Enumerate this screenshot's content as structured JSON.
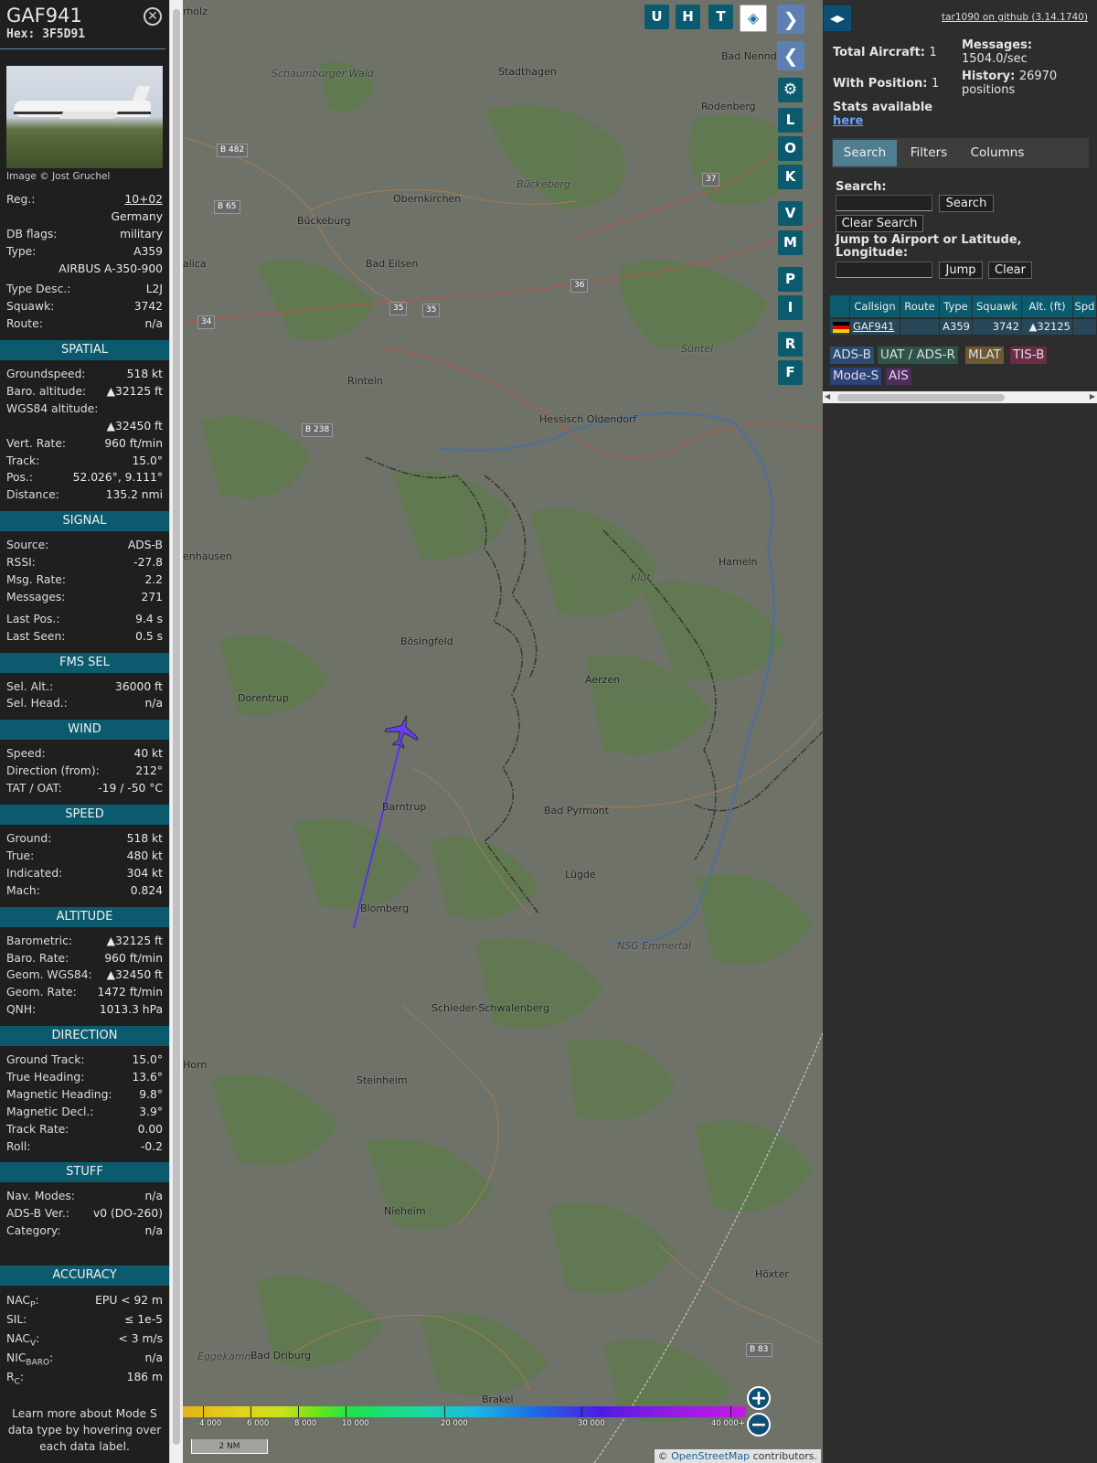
{
  "aircraft": {
    "callsign": "GAF941",
    "hex_label": "Hex:",
    "hex": "3F5D91",
    "photo_credit": "Image © Jost Gruchel"
  },
  "identity": [
    {
      "label": "Reg.:",
      "value": "10+02"
    },
    {
      "label": "",
      "value": "Germany"
    },
    {
      "label": "DB flags:",
      "value": "military"
    },
    {
      "label": "Type:",
      "value": "A359"
    },
    {
      "label": "",
      "value": "AIRBUS A-350-900"
    },
    {
      "label": "Type Desc.:",
      "value": "L2J"
    },
    {
      "label": "Squawk:",
      "value": "3742"
    },
    {
      "label": "Route:",
      "value": "n/a"
    }
  ],
  "sections": [
    {
      "title": "SPATIAL",
      "rows": [
        {
          "label": "Groundspeed:",
          "value": "518 kt"
        },
        {
          "label": "Baro. altitude:",
          "value": "▲32125 ft"
        },
        {
          "label": "WGS84 altitude:",
          "value": ""
        },
        {
          "label": "",
          "value": "▲32450 ft"
        },
        {
          "label": "Vert. Rate:",
          "value": "960 ft/min"
        },
        {
          "label": "Track:",
          "value": "15.0°"
        },
        {
          "label": "Pos.:",
          "value": "52.026°, 9.111°"
        },
        {
          "label": "Distance:",
          "value": "135.2 nmi"
        }
      ]
    },
    {
      "title": "SIGNAL",
      "rows": [
        {
          "label": "Source:",
          "value": "ADS-B"
        },
        {
          "label": "RSSI:",
          "value": "-27.8"
        },
        {
          "label": "Msg. Rate:",
          "value": "2.2"
        },
        {
          "label": "Messages:",
          "value": "271"
        },
        {
          "label": "Last Pos.:",
          "value": "9.4 s"
        },
        {
          "label": "Last Seen:",
          "value": "0.5 s"
        }
      ]
    },
    {
      "title": "FMS SEL",
      "rows": [
        {
          "label": "Sel. Alt.:",
          "value": "36000 ft"
        },
        {
          "label": "Sel. Head.:",
          "value": "n/a"
        }
      ]
    },
    {
      "title": "WIND",
      "rows": [
        {
          "label": "Speed:",
          "value": "40 kt"
        },
        {
          "label": "Direction (from):",
          "value": "212°"
        },
        {
          "label": "TAT / OAT:",
          "value": "-19 / -50 °C"
        }
      ]
    },
    {
      "title": "SPEED",
      "rows": [
        {
          "label": "Ground:",
          "value": "518 kt"
        },
        {
          "label": "True:",
          "value": "480 kt"
        },
        {
          "label": "Indicated:",
          "value": "304 kt"
        },
        {
          "label": "Mach:",
          "value": "0.824"
        }
      ]
    },
    {
      "title": "ALTITUDE",
      "rows": [
        {
          "label": "Barometric:",
          "value": "▲32125 ft"
        },
        {
          "label": "Baro. Rate:",
          "value": "960 ft/min"
        },
        {
          "label": "Geom. WGS84:",
          "value": "▲32450 ft"
        },
        {
          "label": "Geom. Rate:",
          "value": "1472 ft/min"
        },
        {
          "label": "QNH:",
          "value": "1013.3 hPa"
        }
      ]
    },
    {
      "title": "DIRECTION",
      "rows": [
        {
          "label": "Ground Track:",
          "value": "15.0°"
        },
        {
          "label": "True Heading:",
          "value": "13.6°"
        },
        {
          "label": "Magnetic Heading:",
          "value": "9.8°"
        },
        {
          "label": "Magnetic Decl.:",
          "value": "3.9°"
        },
        {
          "label": "Track Rate:",
          "value": "0.00"
        },
        {
          "label": "Roll:",
          "value": "-0.2"
        }
      ]
    },
    {
      "title": "STUFF",
      "rows": [
        {
          "label": "Nav. Modes:",
          "value": "n/a"
        },
        {
          "label": "ADS-B Ver.:",
          "value": "v0 (DO-260)"
        },
        {
          "label": "Category:",
          "value": "n/a"
        }
      ]
    }
  ],
  "accuracy": {
    "title": "ACCURACY",
    "nacp_label": "NAC",
    "nacp_sub": "P",
    "nacp_value": "EPU < 92 m",
    "sil_label": "SIL:",
    "sil_value": "≤ 1e-5",
    "nacv_label": "NAC",
    "nacv_sub": "V",
    "nacv_value": "< 3 m/s",
    "nicbaro_label": "NIC",
    "nicbaro_sub": "BARO",
    "nicbaro_value": "n/a",
    "rc_label": "R",
    "rc_sub": "C",
    "rc_value": "186 m"
  },
  "learn_more": "Learn more about Mode S data type by hovering over each data label.",
  "map": {
    "places": [
      "Schaumburger Wald",
      "Stadthagen",
      "Bad Nenndorf",
      "Rodenberg",
      "Bückeburg",
      "Obernkirchen",
      "Bückeberg",
      "Bad Eilsen",
      "alica",
      "Rinteln",
      "Süntel",
      "Hessisch Oldendorf",
      "enhausen",
      "Hameln",
      "Klüt",
      "Bösingfeld",
      "Aerzen",
      "Dorentrup",
      "Barntrup",
      "Bad Pyrmont",
      "Lügde",
      "Blomberg",
      "NSG Emmertal",
      "Schieder-Schwalenberg",
      "Horn",
      "Steinheim",
      "Nieheim",
      "Höxter",
      "Eggekamm",
      "Bad Driburg",
      "Brakel",
      "rholz"
    ],
    "roads": [
      "B 482",
      "B 65",
      "37",
      "35",
      "35",
      "34",
      "36",
      "B 238",
      "B 83"
    ],
    "buttons": [
      "U",
      "H",
      "T",
      "L",
      "O",
      "K",
      "V",
      "M",
      "P",
      "I",
      "R",
      "F"
    ],
    "zoom_in": "+",
    "zoom_out": "−",
    "altitude_ticks": [
      "4 000",
      "6 000",
      "8 000",
      "10 000",
      "20 000",
      "30 000",
      "40 000+"
    ],
    "scale": "2 NM",
    "attribution_prefix": "© ",
    "attribution_link": "OpenStreetMap",
    "attribution_suffix": " contributors.",
    "track_color": "#5a2bff",
    "aircraft_color": "#6a3ff0"
  },
  "panel": {
    "github": "tar1090 on github (3.14.1740)",
    "total_label": "Total Aircraft:",
    "total_value": "1",
    "withpos_label": "With Position:",
    "withpos_value": "1",
    "messages_label": "Messages:",
    "messages_value": "1504.0/sec",
    "history_label": "History:",
    "history_value": "26970 positions",
    "stats_label": "Stats available",
    "stats_link": "here",
    "tabs": [
      "Search",
      "Filters",
      "Columns"
    ],
    "search_label": "Search:",
    "search_button": "Search",
    "clear_search_button": "Clear Search",
    "jump_label": "Jump to Airport or Latitude, Longitude:",
    "jump_button": "Jump",
    "clear_button": "Clear",
    "table_headers": [
      "Callsign",
      "Route",
      "Type",
      "Squawk",
      "Alt. (ft)",
      "Spd"
    ],
    "table_row": {
      "callsign": "GAF941",
      "route": "",
      "type": "A359",
      "squawk": "3742",
      "alt": "▲32125"
    },
    "source_chips": [
      "ADS-B",
      "UAT / ADS-R",
      "MLAT",
      "TIS-B",
      "Mode-S",
      "AIS"
    ]
  }
}
